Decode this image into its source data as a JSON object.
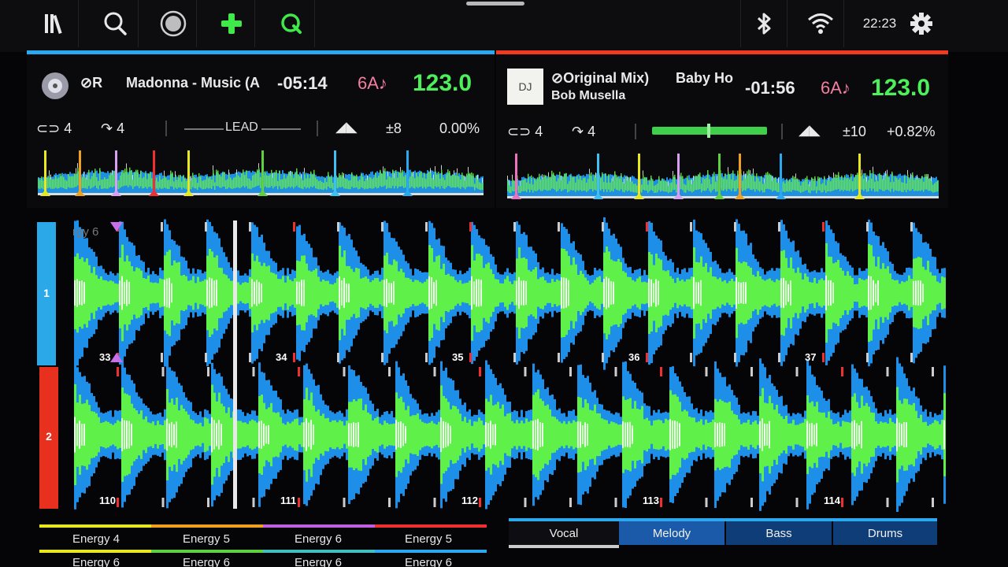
{
  "toolbar": {
    "icons": [
      "library-icon",
      "search-icon",
      "record-icon",
      "add-icon",
      "quantize-icon",
      "bluetooth-icon",
      "wifi-icon",
      "settings-icon"
    ],
    "clock": "22:23",
    "accent_green": "#3fe94a"
  },
  "deck1": {
    "color": "#2aa8f0",
    "source_badge": "R",
    "title": "Madonna - Music (A",
    "time": "-05:14",
    "key": "6A",
    "bpm": "123.0",
    "loop": "4",
    "beatjump": "4",
    "mode": "LEAD",
    "pitch_range": "±8",
    "pitch": "0.00%"
  },
  "deck2": {
    "color": "#f03a22",
    "art_label": "DJ",
    "title": "Original Mix)",
    "title2": "Baby Ho",
    "artist": "Bob Musella",
    "time": "-01:56",
    "key": "6A",
    "bpm": "123.0",
    "loop": "4",
    "beatjump": "4",
    "pitch_range": "±10",
    "pitch": "+0.82%"
  },
  "waveform": {
    "deck1_label": "1",
    "deck2_label": "2",
    "cue_label": "rgy 6",
    "deck1_beats": [
      "33",
      "34",
      "35",
      "36",
      "37"
    ],
    "deck2_beats": [
      "110",
      "111",
      "112",
      "113",
      "114"
    ]
  },
  "pads": {
    "row1": [
      "Energy 4",
      "Energy 5",
      "Energy 6",
      "Energy 5"
    ],
    "row2": [
      "Energy 6",
      "Energy 6",
      "Energy 6",
      "Energy 6"
    ]
  },
  "stems": [
    "Vocal",
    "Melody",
    "Bass",
    "Drums"
  ]
}
